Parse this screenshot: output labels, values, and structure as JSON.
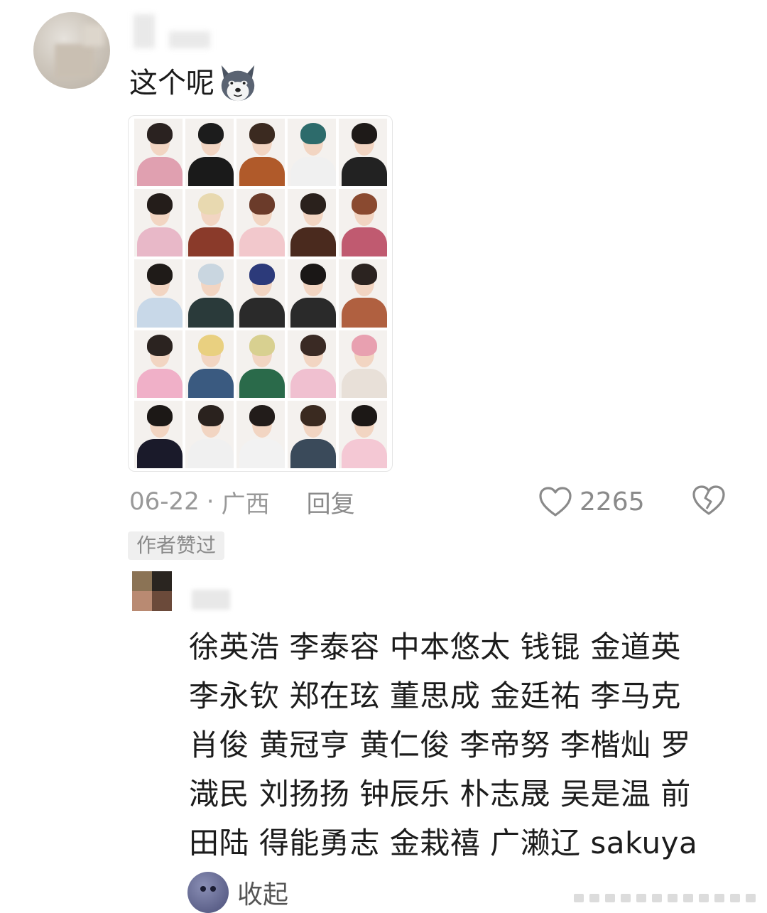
{
  "comment": {
    "text": "这个呢",
    "sticker": "husky-dog-face-icon",
    "date": "06-22",
    "separator": "·",
    "location": "广西",
    "reply_label": "回复",
    "like_count": "2265",
    "author_badge": "作者赞过"
  },
  "reply": {
    "lines": [
      "徐英浩 李泰容 中本悠太 钱锟 金道英",
      "李永钦 郑在玹 董思成 金廷祐 李马克",
      "肖俊 黄冠亨 黄仁俊 李帝努 李楷灿 罗",
      "渽民 刘扬扬 钟辰乐 朴志晟 吴是温 前",
      "田陆 得能勇志 金栽禧 广濑辽 sakuya"
    ],
    "collapse_label": "收起"
  },
  "colors": {
    "meta_text": "#999999",
    "badge_bg": "#efefef",
    "body_text": "#1c1c1c"
  }
}
